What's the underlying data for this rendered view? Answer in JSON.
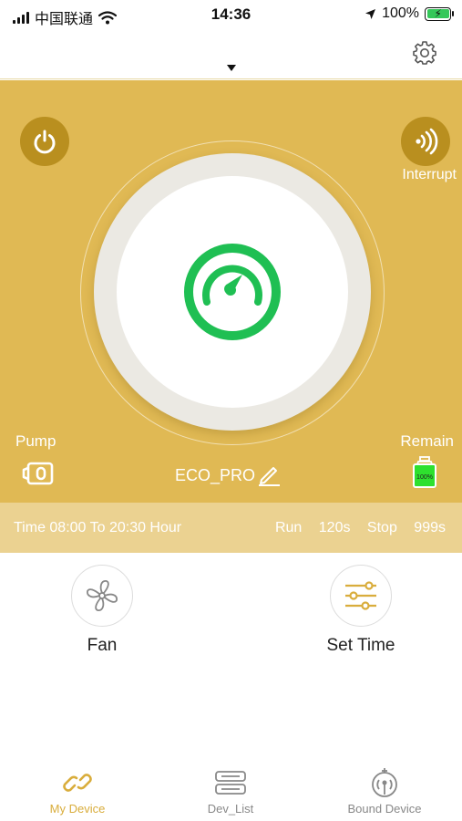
{
  "status_bar": {
    "carrier": "中国联通",
    "time": "14:36",
    "battery_percent": "100%",
    "icons": [
      "signal-icon",
      "wifi-icon",
      "location-arrow-icon",
      "battery-charging-icon"
    ]
  },
  "header": {
    "icons": [
      "dropdown-caret-icon",
      "gear-icon"
    ]
  },
  "control_panel": {
    "interrupt_label": "Interrupt",
    "pump_label": "Pump",
    "remain_label": "Remain",
    "remain_level": "100%",
    "mode_name": "ECO_PRO",
    "icons": [
      "power-icon",
      "interrupt-icon",
      "gauge-icon",
      "pump-icon",
      "remain-bottle-icon",
      "edit-pencil-icon"
    ],
    "colors": {
      "panel": "#e0b954",
      "button": "#b98f1f",
      "gauge": "#1fbf53"
    }
  },
  "schedule": {
    "time_text": "Time 08:00 To 20:30 Hour",
    "run_label": "Run",
    "run_value": "120s",
    "stop_label": "Stop",
    "stop_value": "999s"
  },
  "actions": {
    "fan_label": "Fan",
    "set_time_label": "Set Time",
    "icons": [
      "fan-icon",
      "sliders-icon"
    ]
  },
  "tabbar": {
    "items": [
      {
        "label": "My Device",
        "icon": "link-icon",
        "active": true
      },
      {
        "label": "Dev_List",
        "icon": "list-icon",
        "active": false
      },
      {
        "label": "Bound Device",
        "icon": "broadcast-icon",
        "active": false
      }
    ],
    "colors": {
      "active": "#d9ad3c",
      "inactive": "#888888"
    }
  }
}
